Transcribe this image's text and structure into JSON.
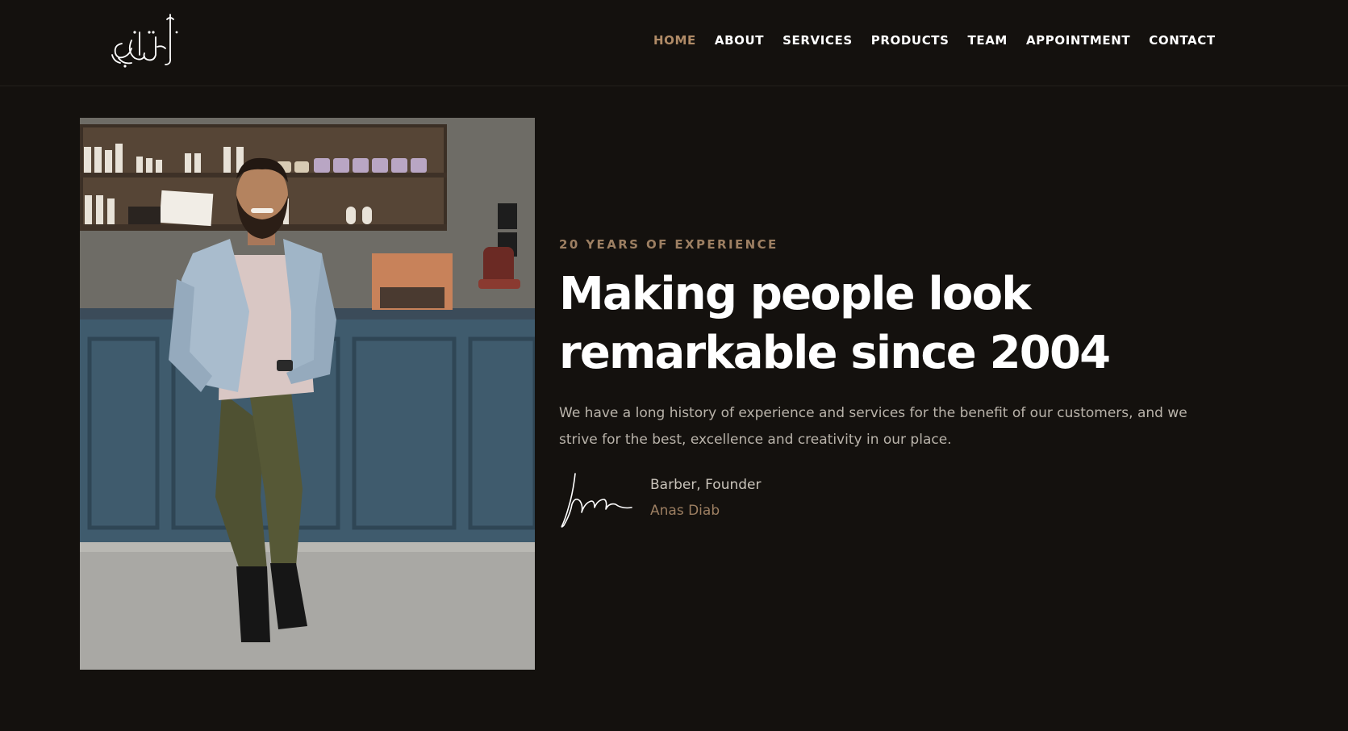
{
  "header": {
    "logo_text": "أنس دياب",
    "nav": [
      {
        "label": "HOME",
        "active": true
      },
      {
        "label": "ABOUT",
        "active": false
      },
      {
        "label": "SERVICES",
        "active": false
      },
      {
        "label": "PRODUCTS",
        "active": false
      },
      {
        "label": "TEAM",
        "active": false
      },
      {
        "label": "APPOINTMENT",
        "active": false
      },
      {
        "label": "CONTACT",
        "active": false
      }
    ]
  },
  "hero": {
    "eyebrow": "20 YEARS OF EXPERIENCE",
    "headline": "Making people look remarkable since 2004",
    "description": "We have a long history of experience and services for the benefit of our customers, and we strive for the best, excellence and creativity in our place.",
    "founder_role": "Barber, Founder",
    "founder_name": "Anas Diab"
  },
  "colors": {
    "background": "#14110e",
    "accent": "#b08b67",
    "text": "#ffffff",
    "muted_text": "#b9b3aa"
  }
}
